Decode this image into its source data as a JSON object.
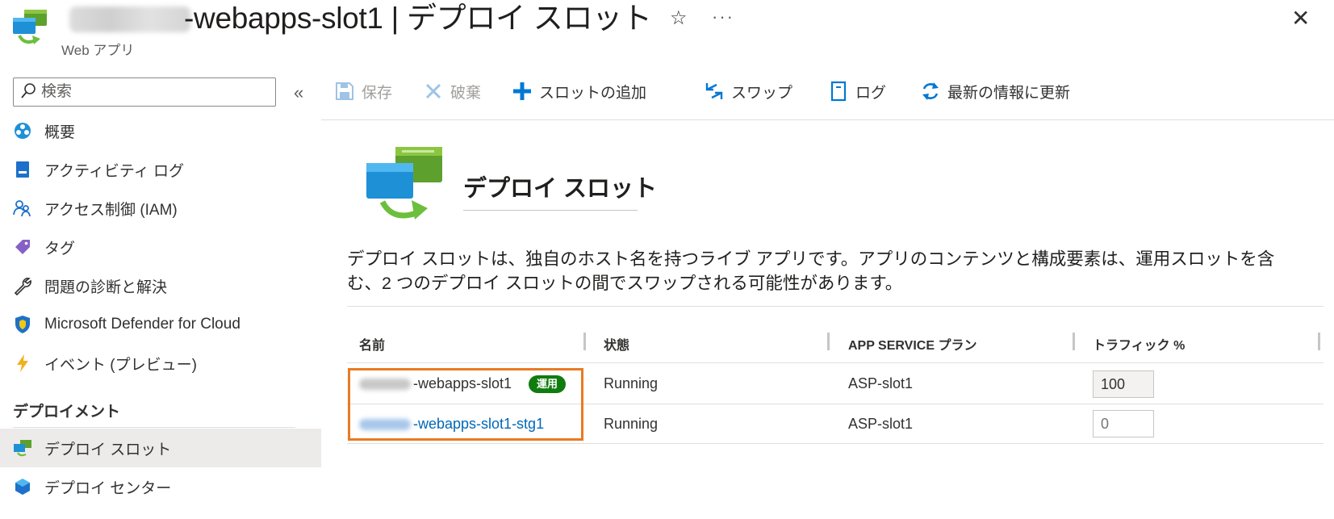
{
  "header": {
    "title": "-webapps-slot1 | デプロイ スロット",
    "subtitle": "Web アプリ",
    "icons": {
      "resource": "web-app-slot-icon",
      "favorite": "star-icon",
      "more": "more-icon",
      "close": "close-icon"
    },
    "favorite_glyph": "☆",
    "more_glyph": "···",
    "close_glyph": "✕"
  },
  "sidebar": {
    "search_placeholder": "検索",
    "collapse_glyph": "«",
    "items": [
      {
        "label": "概要",
        "icon": "overview-icon"
      },
      {
        "label": "アクティビティ ログ",
        "icon": "activity-log-icon"
      },
      {
        "label": "アクセス制御 (IAM)",
        "icon": "access-control-icon"
      },
      {
        "label": "タグ",
        "icon": "tag-icon"
      },
      {
        "label": "問題の診断と解決",
        "icon": "wrench-icon"
      },
      {
        "label": "Microsoft Defender for Cloud",
        "icon": "defender-shield-icon"
      },
      {
        "label": "イベント (プレビュー)",
        "icon": "lightning-icon"
      }
    ],
    "section_title": "デプロイメント",
    "section_items": [
      {
        "label": "デプロイ スロット",
        "icon": "deployment-slot-icon",
        "selected": true
      },
      {
        "label": "デプロイ センター",
        "icon": "deployment-center-icon",
        "selected": false
      }
    ]
  },
  "toolbar": {
    "save": {
      "label": "保存",
      "icon": "save-icon",
      "disabled": true
    },
    "discard": {
      "label": "破棄",
      "icon": "discard-icon",
      "disabled": true
    },
    "add_slot": {
      "label": "スロットの追加",
      "icon": "plus-icon"
    },
    "swap": {
      "label": "スワップ",
      "icon": "swap-icon"
    },
    "log": {
      "label": "ログ",
      "icon": "log-icon"
    },
    "refresh": {
      "label": "最新の情報に更新",
      "icon": "refresh-icon"
    }
  },
  "main": {
    "heading": "デプロイ スロット",
    "description": "デプロイ スロットは、独自のホスト名を持つライブ アプリです。アプリのコンテンツと構成要素は、運用スロットを含む、2 つのデプロイ スロットの間でスワップされる可能性があります。",
    "table": {
      "columns": [
        "名前",
        "状態",
        "APP SERVICE プラン",
        "トラフィック %"
      ],
      "rows": [
        {
          "name": "-webapps-slot1",
          "badge": "運用",
          "status": "Running",
          "plan": "ASP-slot1",
          "traffic": "100"
        },
        {
          "name": "-webapps-slot1-stg1",
          "status": "Running",
          "plan": "ASP-slot1",
          "traffic_placeholder": "0"
        }
      ]
    }
  },
  "colors": {
    "accent_blue": "#0078d4",
    "link_blue": "#0067b8",
    "production_badge": "#107c10",
    "highlight_orange": "#e97a23",
    "selected_nav_bg": "#edebe9"
  }
}
